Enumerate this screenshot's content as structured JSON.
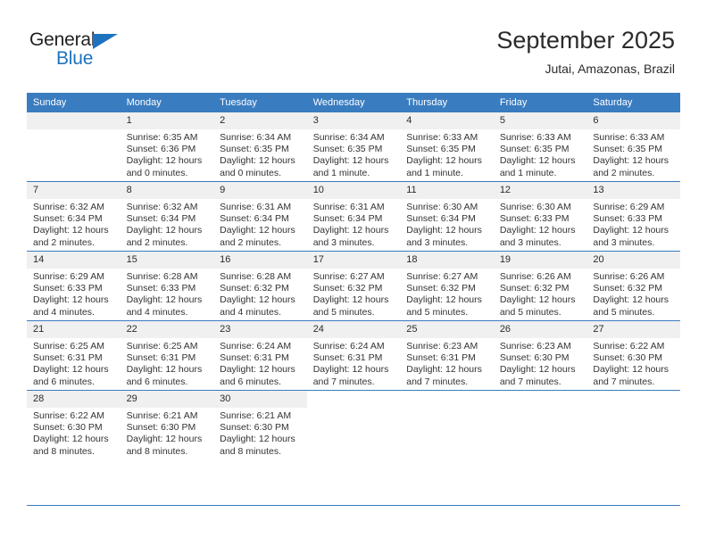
{
  "brand": {
    "word_one": "General",
    "word_two": "Blue",
    "triangle_icon": "triangle-icon",
    "accent_color": "#1e73be"
  },
  "header": {
    "title": "September 2025",
    "subtitle": "Jutai, Amazonas, Brazil"
  },
  "theme": {
    "header_bg": "#3a7cc0",
    "daynum_bg": "#f0f0f0",
    "grid_line": "#3a7cc0"
  },
  "weekdays": [
    "Sunday",
    "Monday",
    "Tuesday",
    "Wednesday",
    "Thursday",
    "Friday",
    "Saturday"
  ],
  "weeks": [
    [
      {
        "day": "",
        "sunrise": "",
        "sunset": "",
        "daylight_line1": "",
        "daylight_line2": ""
      },
      {
        "day": "1",
        "sunrise": "Sunrise: 6:35 AM",
        "sunset": "Sunset: 6:36 PM",
        "daylight_line1": "Daylight: 12 hours",
        "daylight_line2": "and 0 minutes."
      },
      {
        "day": "2",
        "sunrise": "Sunrise: 6:34 AM",
        "sunset": "Sunset: 6:35 PM",
        "daylight_line1": "Daylight: 12 hours",
        "daylight_line2": "and 0 minutes."
      },
      {
        "day": "3",
        "sunrise": "Sunrise: 6:34 AM",
        "sunset": "Sunset: 6:35 PM",
        "daylight_line1": "Daylight: 12 hours",
        "daylight_line2": "and 1 minute."
      },
      {
        "day": "4",
        "sunrise": "Sunrise: 6:33 AM",
        "sunset": "Sunset: 6:35 PM",
        "daylight_line1": "Daylight: 12 hours",
        "daylight_line2": "and 1 minute."
      },
      {
        "day": "5",
        "sunrise": "Sunrise: 6:33 AM",
        "sunset": "Sunset: 6:35 PM",
        "daylight_line1": "Daylight: 12 hours",
        "daylight_line2": "and 1 minute."
      },
      {
        "day": "6",
        "sunrise": "Sunrise: 6:33 AM",
        "sunset": "Sunset: 6:35 PM",
        "daylight_line1": "Daylight: 12 hours",
        "daylight_line2": "and 2 minutes."
      }
    ],
    [
      {
        "day": "7",
        "sunrise": "Sunrise: 6:32 AM",
        "sunset": "Sunset: 6:34 PM",
        "daylight_line1": "Daylight: 12 hours",
        "daylight_line2": "and 2 minutes."
      },
      {
        "day": "8",
        "sunrise": "Sunrise: 6:32 AM",
        "sunset": "Sunset: 6:34 PM",
        "daylight_line1": "Daylight: 12 hours",
        "daylight_line2": "and 2 minutes."
      },
      {
        "day": "9",
        "sunrise": "Sunrise: 6:31 AM",
        "sunset": "Sunset: 6:34 PM",
        "daylight_line1": "Daylight: 12 hours",
        "daylight_line2": "and 2 minutes."
      },
      {
        "day": "10",
        "sunrise": "Sunrise: 6:31 AM",
        "sunset": "Sunset: 6:34 PM",
        "daylight_line1": "Daylight: 12 hours",
        "daylight_line2": "and 3 minutes."
      },
      {
        "day": "11",
        "sunrise": "Sunrise: 6:30 AM",
        "sunset": "Sunset: 6:34 PM",
        "daylight_line1": "Daylight: 12 hours",
        "daylight_line2": "and 3 minutes."
      },
      {
        "day": "12",
        "sunrise": "Sunrise: 6:30 AM",
        "sunset": "Sunset: 6:33 PM",
        "daylight_line1": "Daylight: 12 hours",
        "daylight_line2": "and 3 minutes."
      },
      {
        "day": "13",
        "sunrise": "Sunrise: 6:29 AM",
        "sunset": "Sunset: 6:33 PM",
        "daylight_line1": "Daylight: 12 hours",
        "daylight_line2": "and 3 minutes."
      }
    ],
    [
      {
        "day": "14",
        "sunrise": "Sunrise: 6:29 AM",
        "sunset": "Sunset: 6:33 PM",
        "daylight_line1": "Daylight: 12 hours",
        "daylight_line2": "and 4 minutes."
      },
      {
        "day": "15",
        "sunrise": "Sunrise: 6:28 AM",
        "sunset": "Sunset: 6:33 PM",
        "daylight_line1": "Daylight: 12 hours",
        "daylight_line2": "and 4 minutes."
      },
      {
        "day": "16",
        "sunrise": "Sunrise: 6:28 AM",
        "sunset": "Sunset: 6:32 PM",
        "daylight_line1": "Daylight: 12 hours",
        "daylight_line2": "and 4 minutes."
      },
      {
        "day": "17",
        "sunrise": "Sunrise: 6:27 AM",
        "sunset": "Sunset: 6:32 PM",
        "daylight_line1": "Daylight: 12 hours",
        "daylight_line2": "and 5 minutes."
      },
      {
        "day": "18",
        "sunrise": "Sunrise: 6:27 AM",
        "sunset": "Sunset: 6:32 PM",
        "daylight_line1": "Daylight: 12 hours",
        "daylight_line2": "and 5 minutes."
      },
      {
        "day": "19",
        "sunrise": "Sunrise: 6:26 AM",
        "sunset": "Sunset: 6:32 PM",
        "daylight_line1": "Daylight: 12 hours",
        "daylight_line2": "and 5 minutes."
      },
      {
        "day": "20",
        "sunrise": "Sunrise: 6:26 AM",
        "sunset": "Sunset: 6:32 PM",
        "daylight_line1": "Daylight: 12 hours",
        "daylight_line2": "and 5 minutes."
      }
    ],
    [
      {
        "day": "21",
        "sunrise": "Sunrise: 6:25 AM",
        "sunset": "Sunset: 6:31 PM",
        "daylight_line1": "Daylight: 12 hours",
        "daylight_line2": "and 6 minutes."
      },
      {
        "day": "22",
        "sunrise": "Sunrise: 6:25 AM",
        "sunset": "Sunset: 6:31 PM",
        "daylight_line1": "Daylight: 12 hours",
        "daylight_line2": "and 6 minutes."
      },
      {
        "day": "23",
        "sunrise": "Sunrise: 6:24 AM",
        "sunset": "Sunset: 6:31 PM",
        "daylight_line1": "Daylight: 12 hours",
        "daylight_line2": "and 6 minutes."
      },
      {
        "day": "24",
        "sunrise": "Sunrise: 6:24 AM",
        "sunset": "Sunset: 6:31 PM",
        "daylight_line1": "Daylight: 12 hours",
        "daylight_line2": "and 7 minutes."
      },
      {
        "day": "25",
        "sunrise": "Sunrise: 6:23 AM",
        "sunset": "Sunset: 6:31 PM",
        "daylight_line1": "Daylight: 12 hours",
        "daylight_line2": "and 7 minutes."
      },
      {
        "day": "26",
        "sunrise": "Sunrise: 6:23 AM",
        "sunset": "Sunset: 6:30 PM",
        "daylight_line1": "Daylight: 12 hours",
        "daylight_line2": "and 7 minutes."
      },
      {
        "day": "27",
        "sunrise": "Sunrise: 6:22 AM",
        "sunset": "Sunset: 6:30 PM",
        "daylight_line1": "Daylight: 12 hours",
        "daylight_line2": "and 7 minutes."
      }
    ],
    [
      {
        "day": "28",
        "sunrise": "Sunrise: 6:22 AM",
        "sunset": "Sunset: 6:30 PM",
        "daylight_line1": "Daylight: 12 hours",
        "daylight_line2": "and 8 minutes."
      },
      {
        "day": "29",
        "sunrise": "Sunrise: 6:21 AM",
        "sunset": "Sunset: 6:30 PM",
        "daylight_line1": "Daylight: 12 hours",
        "daylight_line2": "and 8 minutes."
      },
      {
        "day": "30",
        "sunrise": "Sunrise: 6:21 AM",
        "sunset": "Sunset: 6:30 PM",
        "daylight_line1": "Daylight: 12 hours",
        "daylight_line2": "and 8 minutes."
      },
      {
        "day": "",
        "sunrise": "",
        "sunset": "",
        "daylight_line1": "",
        "daylight_line2": ""
      },
      {
        "day": "",
        "sunrise": "",
        "sunset": "",
        "daylight_line1": "",
        "daylight_line2": ""
      },
      {
        "day": "",
        "sunrise": "",
        "sunset": "",
        "daylight_line1": "",
        "daylight_line2": ""
      },
      {
        "day": "",
        "sunrise": "",
        "sunset": "",
        "daylight_line1": "",
        "daylight_line2": ""
      }
    ]
  ]
}
